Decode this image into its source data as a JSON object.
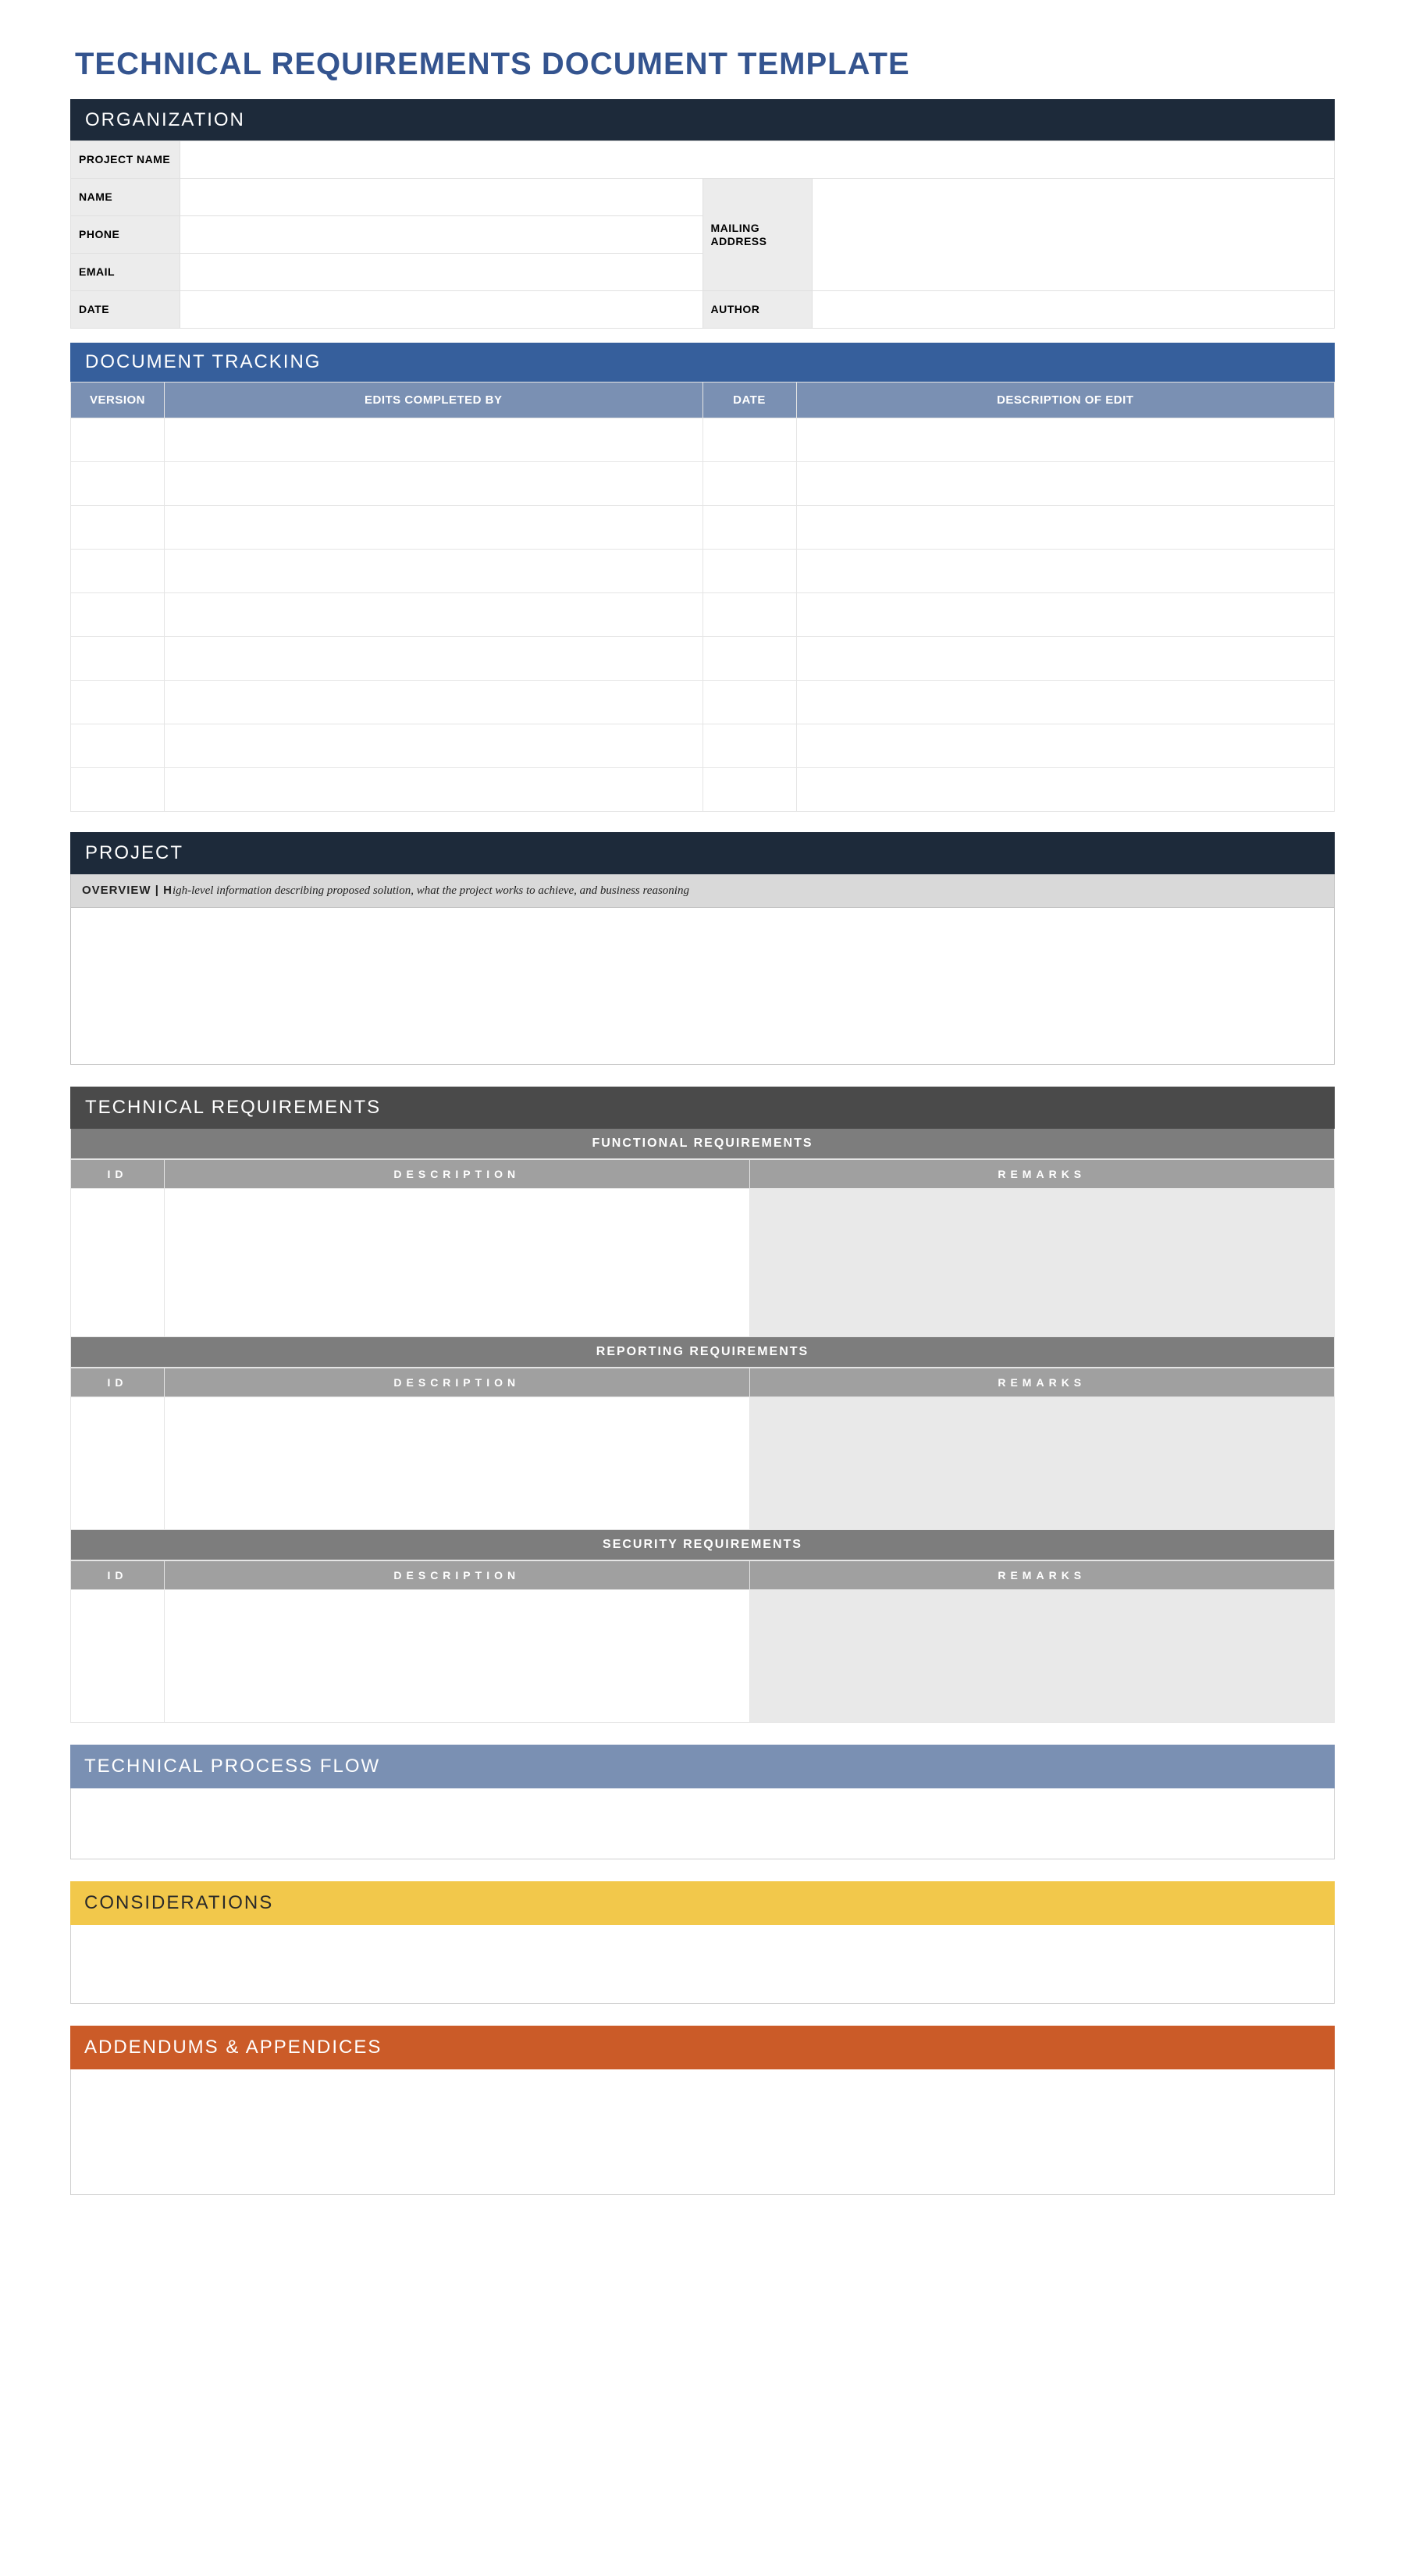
{
  "title": "TECHNICAL REQUIREMENTS DOCUMENT TEMPLATE",
  "organization": {
    "header": "ORGANIZATION",
    "labels": {
      "project_name": "PROJECT NAME",
      "name": "NAME",
      "phone": "PHONE",
      "email": "EMAIL",
      "date": "DATE",
      "mailing_address": "MAILING ADDRESS",
      "author": "AUTHOR"
    },
    "values": {
      "project_name": "",
      "name": "",
      "phone": "",
      "email": "",
      "date": "",
      "mailing_address": "",
      "author": ""
    }
  },
  "doc_tracking": {
    "header": "DOCUMENT TRACKING",
    "columns": {
      "version": "VERSION",
      "edits_by": "EDITS COMPLETED BY",
      "date": "DATE",
      "description": "DESCRIPTION OF EDIT"
    },
    "rows": [
      {
        "version": "",
        "edits_by": "",
        "date": "",
        "description": ""
      },
      {
        "version": "",
        "edits_by": "",
        "date": "",
        "description": ""
      },
      {
        "version": "",
        "edits_by": "",
        "date": "",
        "description": ""
      },
      {
        "version": "",
        "edits_by": "",
        "date": "",
        "description": ""
      },
      {
        "version": "",
        "edits_by": "",
        "date": "",
        "description": ""
      },
      {
        "version": "",
        "edits_by": "",
        "date": "",
        "description": ""
      },
      {
        "version": "",
        "edits_by": "",
        "date": "",
        "description": ""
      },
      {
        "version": "",
        "edits_by": "",
        "date": "",
        "description": ""
      },
      {
        "version": "",
        "edits_by": "",
        "date": "",
        "description": ""
      }
    ]
  },
  "project": {
    "header": "PROJECT",
    "overview_lead": "OVERVIEW  |  H",
    "overview_rest": "igh-level information describing proposed solution, what the project works to achieve, and business reasoning",
    "overview_body": ""
  },
  "technical": {
    "header": "TECHNICAL REQUIREMENTS",
    "columns": {
      "id": "ID",
      "description": "DESCRIPTION",
      "remarks": "REMARKS"
    },
    "functional": {
      "title": "FUNCTIONAL REQUIREMENTS",
      "rows": [
        {
          "id": "",
          "description": "",
          "remarks": ""
        }
      ]
    },
    "reporting": {
      "title": "REPORTING REQUIREMENTS",
      "rows": [
        {
          "id": "",
          "description": "",
          "remarks": ""
        }
      ]
    },
    "security": {
      "title": "SECURITY REQUIREMENTS",
      "rows": [
        {
          "id": "",
          "description": "",
          "remarks": ""
        }
      ]
    }
  },
  "process_flow": {
    "header": "TECHNICAL PROCESS FLOW",
    "body": ""
  },
  "considerations": {
    "header": "CONSIDERATIONS",
    "body": ""
  },
  "addendums": {
    "header": "ADDENDUMS & APPENDICES",
    "body": ""
  }
}
